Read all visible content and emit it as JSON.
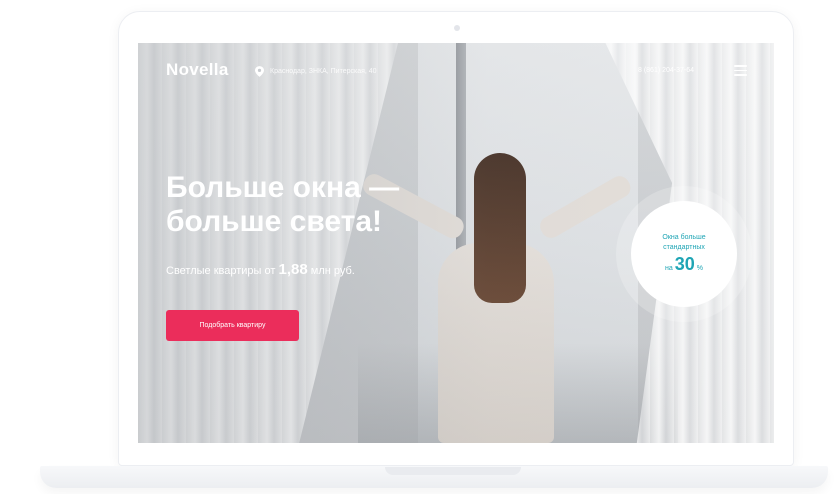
{
  "header": {
    "logo": "Novella",
    "location_icon": "pin-icon",
    "address": "Краснодар, ЗНКА, Питерская, 40",
    "phone": "8 (861) 204-37-64",
    "menu_icon": "hamburger-menu-icon"
  },
  "hero": {
    "title": "Больше окна — больше света!",
    "subtitle_prefix": "Светлые квартиры от",
    "price": "1,88",
    "subtitle_suffix": "млн руб.",
    "cta_label": "Подобрать квартиру"
  },
  "badge": {
    "line1": "Окна больше",
    "line2": "стандартных",
    "prefix": "на",
    "value": "30",
    "unit": "%"
  },
  "colors": {
    "accent": "#eb2d5b",
    "badge_text": "#1fa5b5"
  }
}
